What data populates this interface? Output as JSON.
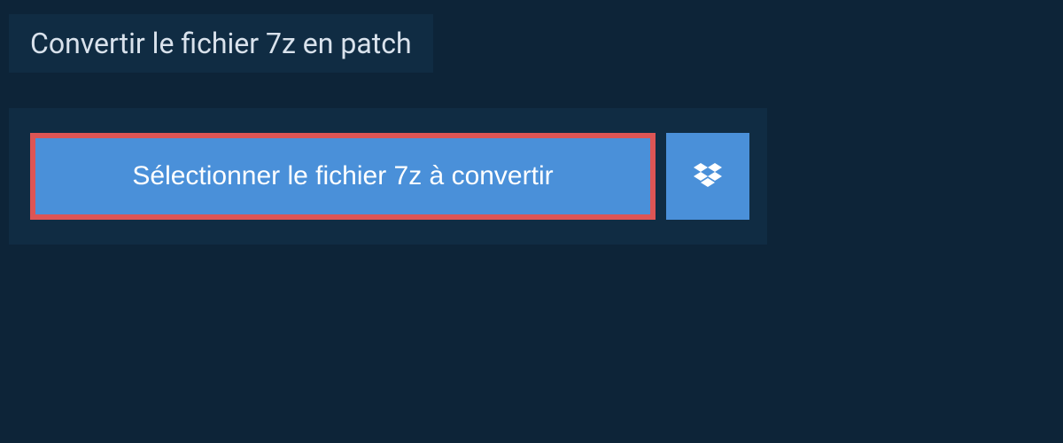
{
  "title": "Convertir le fichier 7z en patch",
  "upload": {
    "select_file_label": "Sélectionner le fichier 7z à convertir"
  },
  "colors": {
    "page_bg": "#0d2438",
    "panel_bg": "#102c43",
    "button_bg": "#4a90d9",
    "highlight_border": "#dd5555",
    "text_light": "#d9e2ec"
  }
}
